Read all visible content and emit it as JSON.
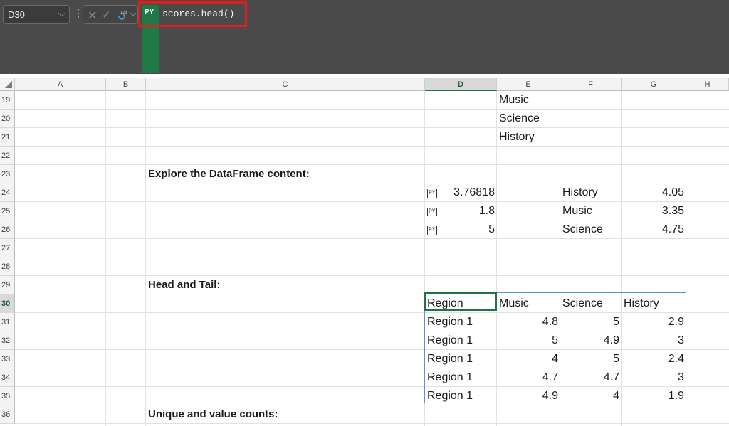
{
  "formula_bar": {
    "name_box": "D30",
    "py_badge": "PY",
    "formula": "scores.head()",
    "icons": [
      "chevron-down-icon",
      "more-dots-icon",
      "cancel-x-icon",
      "enter-check-icon",
      "python-output-123-icon"
    ]
  },
  "columns": [
    "A",
    "B",
    "C",
    "D",
    "E",
    "F",
    "G",
    "H"
  ],
  "active_column": "D",
  "rows": [
    "19",
    "20",
    "21",
    "22",
    "23",
    "24",
    "25",
    "26",
    "27",
    "28",
    "29",
    "30",
    "31",
    "32",
    "33",
    "34",
    "35",
    "36"
  ],
  "active_row": "30",
  "cells": {
    "e19": "Music",
    "e20": "Science",
    "e21": "History",
    "c23": "Explore the DataFrame content:",
    "d24_icon": "PY",
    "d24": "3.76818",
    "f24": "History",
    "g24": "4.05",
    "d25_icon": "PY",
    "d25": "1.8",
    "f25": "Music",
    "g25": "3.35",
    "d26_icon": "PY",
    "d26": "5",
    "f26": "Science",
    "g26": "4.75",
    "c29": "Head and Tail:",
    "c36": "Unique and value counts:"
  },
  "head_table": {
    "headers": [
      "Region",
      "Music",
      "Science",
      "History"
    ],
    "rows": [
      [
        "Region 1",
        "4.8",
        "5",
        "2.9"
      ],
      [
        "Region 1",
        "5",
        "4.9",
        "3"
      ],
      [
        "Region 1",
        "4",
        "5",
        "2.4"
      ],
      [
        "Region 1",
        "4.7",
        "4.7",
        "3"
      ],
      [
        "Region 1",
        "4.9",
        "4",
        "1.9"
      ]
    ]
  },
  "colors": {
    "accent_green": "#217346",
    "python_green": "#1f7a45",
    "highlight_red": "#e01e1e",
    "table_border_blue": "#5b8fd6"
  }
}
